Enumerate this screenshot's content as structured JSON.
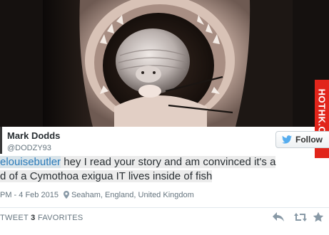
{
  "watermark": {
    "text": "HOTHK.COM",
    "color": "#e1251b"
  },
  "author": {
    "display_name": "Mark Dodds",
    "username": "@DODZY93"
  },
  "follow_button": {
    "label": "Follow",
    "icon": "twitter-bird-icon",
    "icon_color": "#55acee"
  },
  "tweet": {
    "mention": "elouisebutler",
    "line1_rest": " hey I read your story and am convinced it's a",
    "line2": "d of a Cymothoa exigua IT lives inside of fish",
    "mention_color": "#2b7bb9"
  },
  "meta": {
    "timestamp": "PM - 4 Feb 2015",
    "location_icon": "location-pin-icon",
    "location": "Seaham, England, United Kingdom"
  },
  "stats": {
    "retweet_label": "TWEET",
    "favorites_count": "3",
    "favorites_label": "FAVORITES"
  },
  "actions": {
    "reply_icon": "reply-icon",
    "retweet_icon": "retweet-icon",
    "favorite_icon": "star-icon"
  }
}
